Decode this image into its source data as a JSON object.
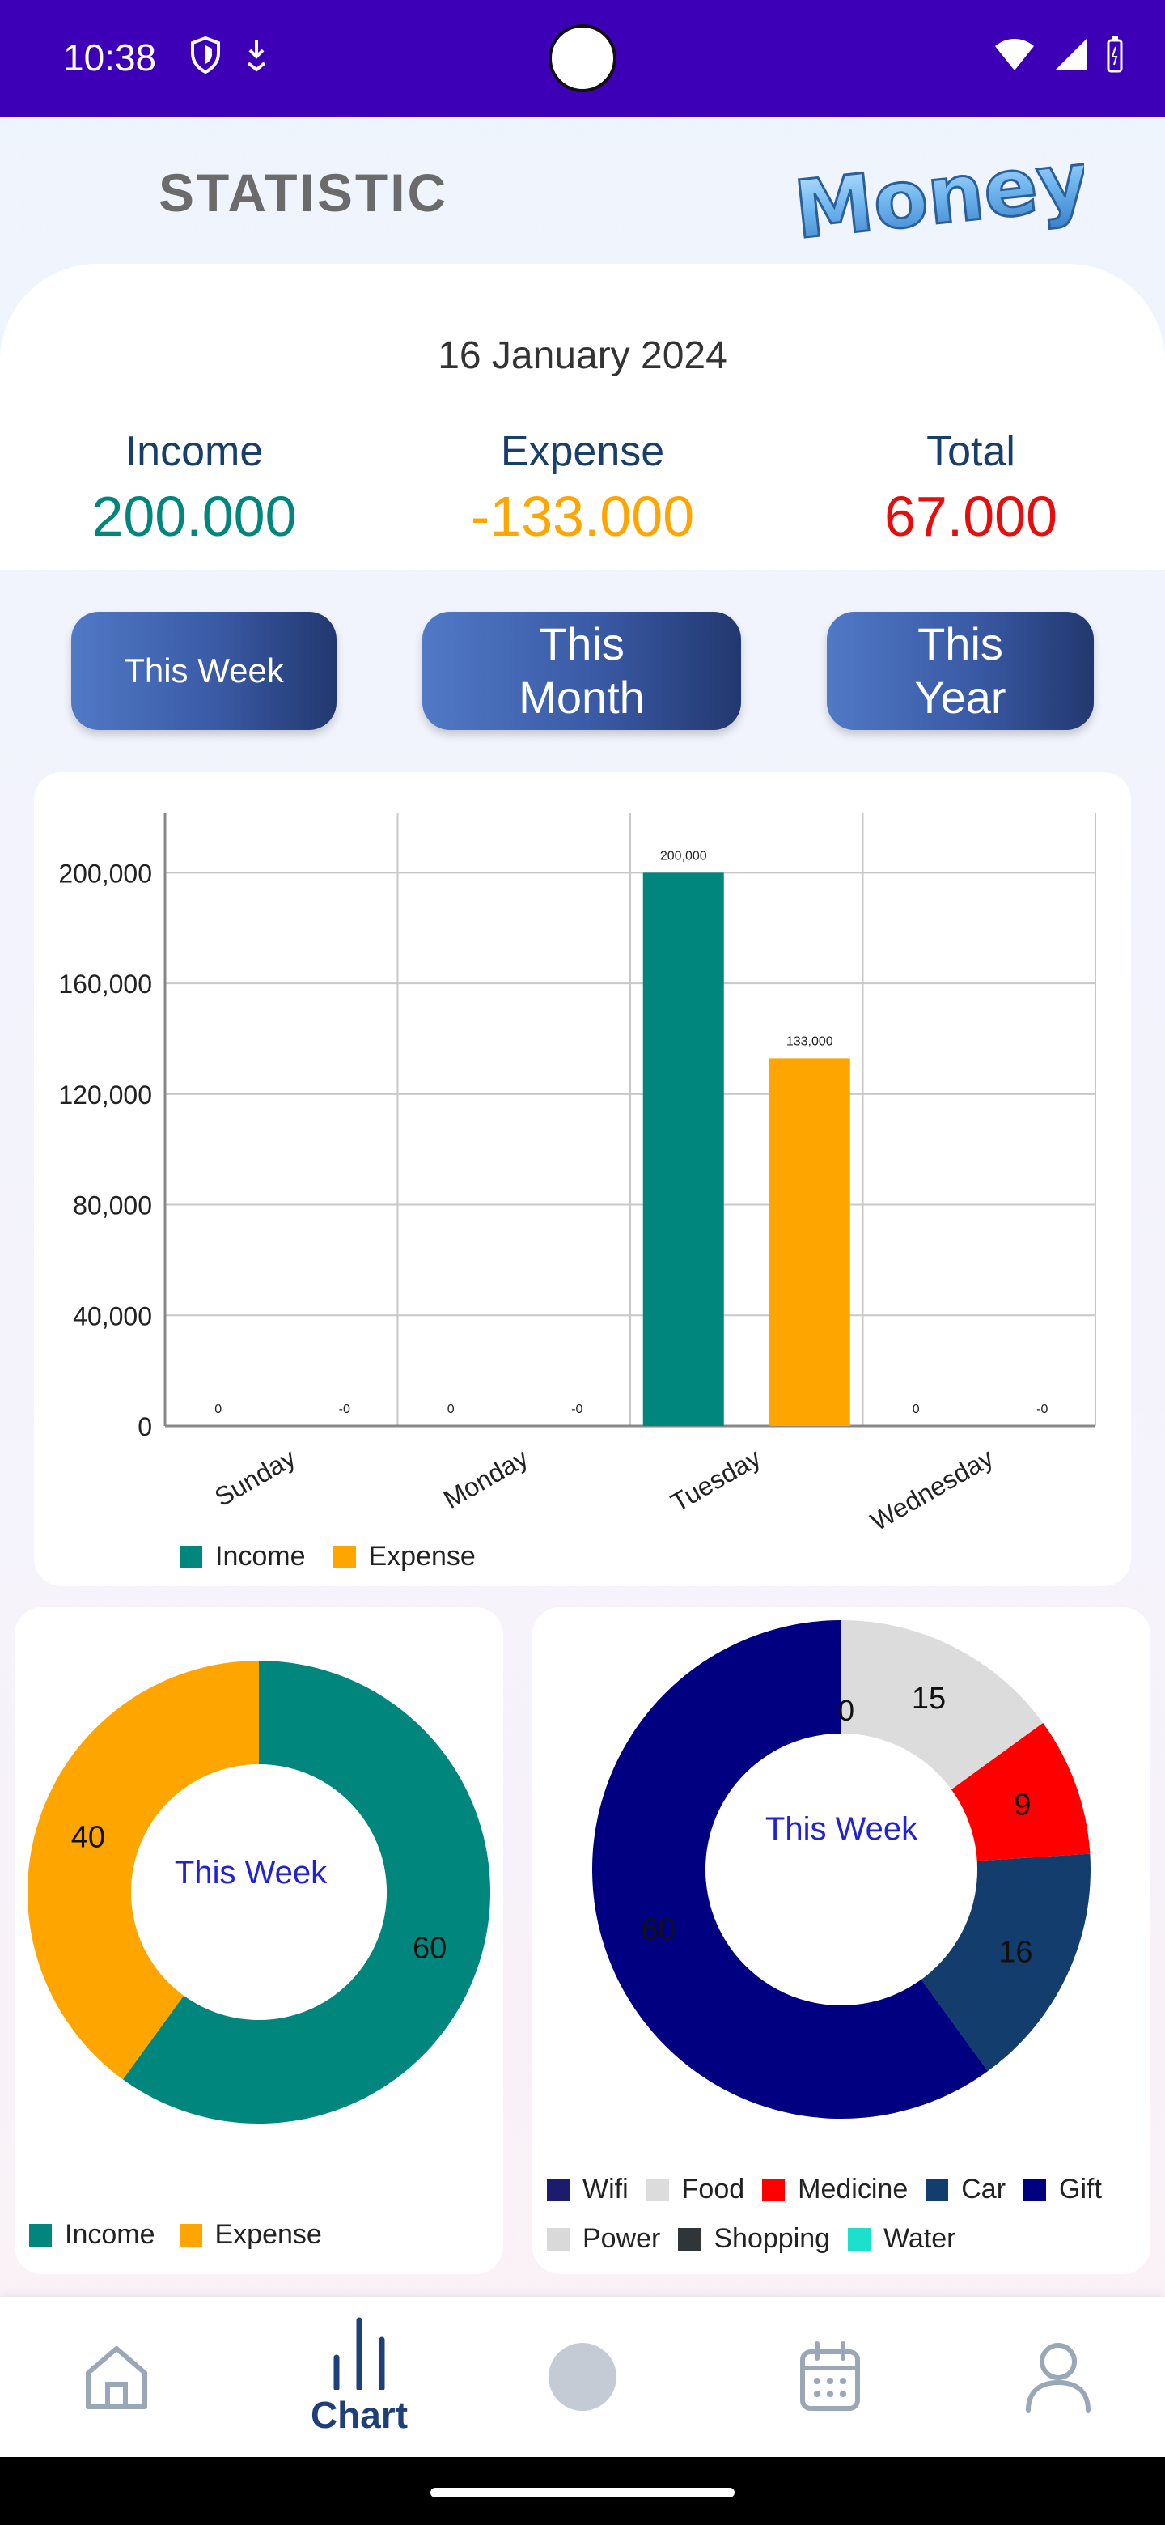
{
  "status_bar": {
    "time": "10:38"
  },
  "header": {
    "title": "STATISTIC",
    "logo_text": "Money"
  },
  "summary": {
    "date": "16 January 2024",
    "income_label": "Income",
    "income_value": "200.000",
    "expense_label": "Expense",
    "expense_value": "-133.000",
    "total_label": "Total",
    "total_value": "67.000"
  },
  "period_buttons": {
    "week": "This Week",
    "month": "This Month",
    "year": "This Year"
  },
  "colors": {
    "income": "#00867d",
    "expense": "#ffa500",
    "total": "#e60d0d",
    "accent": "#3e00b6"
  },
  "chart_data": [
    {
      "type": "bar",
      "categories": [
        "Sunday",
        "Monday",
        "Tuesday",
        "Wednesday"
      ],
      "series": [
        {
          "name": "Income",
          "color": "#00867d",
          "values": [
            0,
            0,
            200000,
            0
          ],
          "labels": [
            "0",
            "0",
            "200,000",
            "0"
          ]
        },
        {
          "name": "Expense",
          "color": "#ffa500",
          "values": [
            0,
            0,
            133000,
            0
          ],
          "labels": [
            "-0",
            "-0",
            "133,000",
            "-0"
          ]
        }
      ],
      "y_ticks": [
        "0",
        "40,000",
        "80,000",
        "120,000",
        "160,000",
        "200,000"
      ],
      "ylim": [
        0,
        220000
      ],
      "grid": true,
      "legend": "bottom-left"
    },
    {
      "type": "pie",
      "center_label": "This Week",
      "slices": [
        {
          "name": "Income",
          "value": 60,
          "color": "#00867d"
        },
        {
          "name": "Expense",
          "value": 40,
          "color": "#ffa500"
        }
      ],
      "legend": "bottom-left"
    },
    {
      "type": "pie",
      "center_label": "This Week",
      "slices": [
        {
          "name": "Wifi",
          "value": 0,
          "color": "#1c1c6e"
        },
        {
          "name": "Food",
          "value": 15,
          "color": "#dcdcdc"
        },
        {
          "name": "Medicine",
          "value": 9,
          "color": "#ff0000"
        },
        {
          "name": "Car",
          "value": 16,
          "color": "#133d6c"
        },
        {
          "name": "Gift",
          "value": 60,
          "color": "#000080"
        },
        {
          "name": "Power",
          "value": 0,
          "color": "#d9d9d9"
        },
        {
          "name": "Shopping",
          "value": 0,
          "color": "#2f3538"
        },
        {
          "name": "Water",
          "value": 0,
          "color": "#1de0cc"
        }
      ],
      "legend": "bottom"
    }
  ],
  "bottom_nav": {
    "chart_label": "Chart",
    "items": [
      "home-icon",
      "chart-icon",
      "center-action",
      "calendar-icon",
      "profile-icon"
    ]
  }
}
